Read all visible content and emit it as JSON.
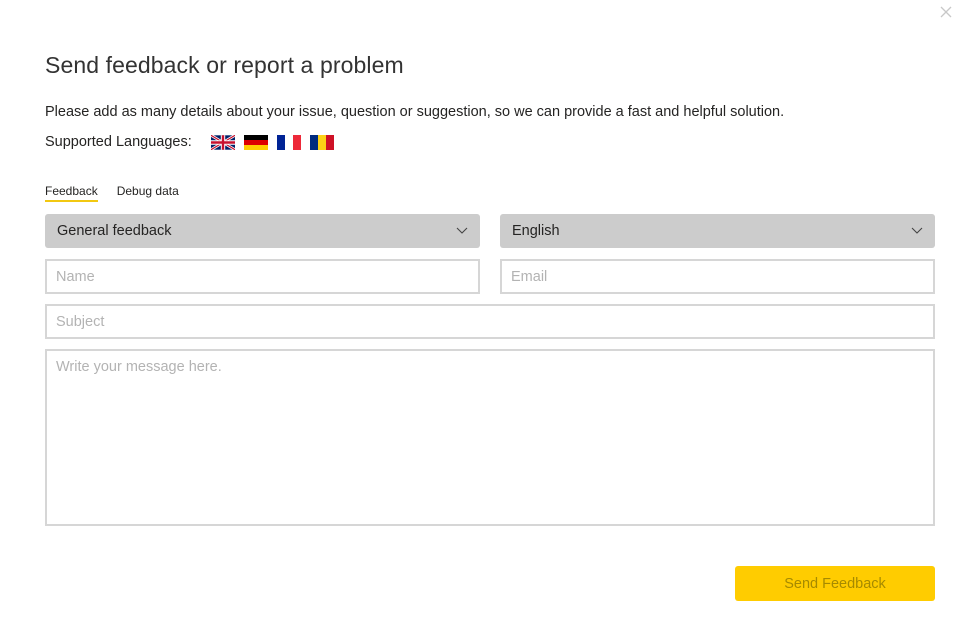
{
  "dialog": {
    "title": "Send feedback or report a problem",
    "description": "Please add as many details about your issue, question or suggestion, so we can provide a fast and helpful solution.",
    "supported_languages_label": "Supported Languages:",
    "flags": [
      {
        "name": "uk-flag-icon",
        "language": "English"
      },
      {
        "name": "germany-flag-icon",
        "language": "German"
      },
      {
        "name": "france-flag-icon",
        "language": "French"
      },
      {
        "name": "romania-flag-icon",
        "language": "Romanian"
      }
    ],
    "close_icon": "close-icon"
  },
  "tabs": [
    {
      "label": "Feedback",
      "active": true
    },
    {
      "label": "Debug data",
      "active": false
    }
  ],
  "form": {
    "feedback_type": {
      "selected": "General feedback"
    },
    "language": {
      "selected": "English"
    },
    "name": {
      "value": "",
      "placeholder": "Name"
    },
    "email": {
      "value": "",
      "placeholder": "Email"
    },
    "subject": {
      "value": "",
      "placeholder": "Subject"
    },
    "message": {
      "value": "",
      "placeholder": "Write your message here."
    },
    "send_label": "Send Feedback"
  },
  "colors": {
    "accent": "#ffcc00",
    "tab_underline": "#f2c811",
    "select_bg": "#cccccc",
    "input_border": "#d6d6d6"
  }
}
